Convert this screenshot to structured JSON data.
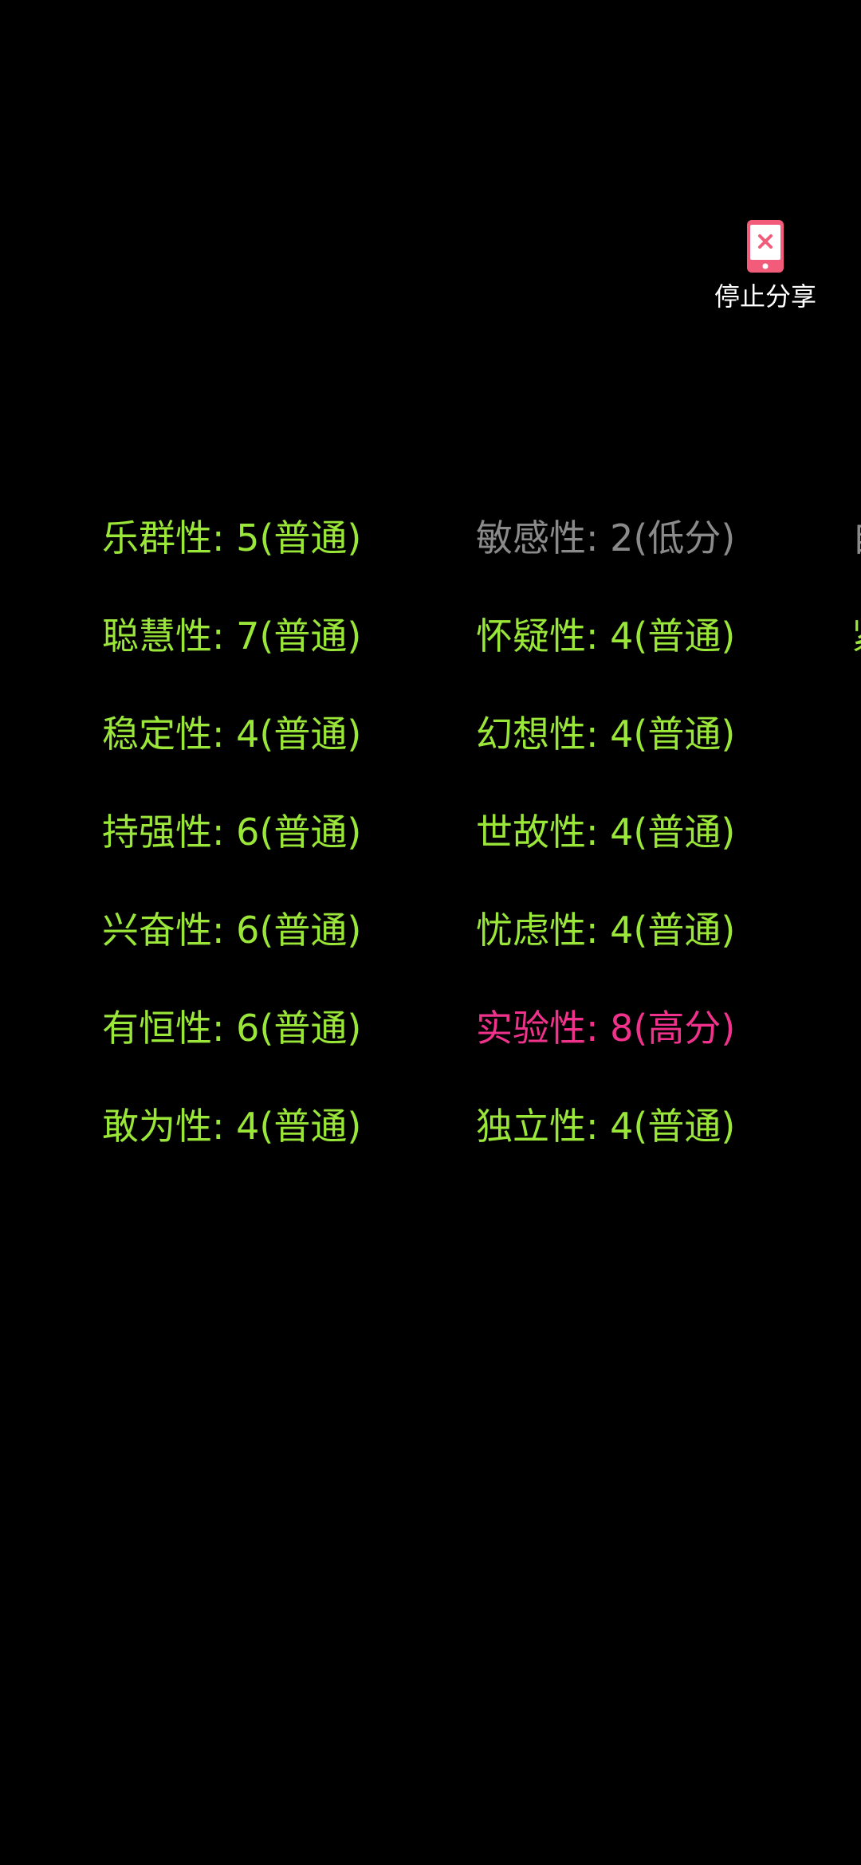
{
  "stop_share": {
    "label": "停止分享",
    "icon": "phone-stop-icon",
    "icon_color": "#f25c7a"
  },
  "colors": {
    "normal": "#9ae639",
    "low": "#8a8a8a",
    "high": "#f0328c"
  },
  "traits": {
    "column_1": [
      {
        "text": "乐群性: 5(普通)",
        "level": "normal"
      },
      {
        "text": "聪慧性: 7(普通)",
        "level": "normal"
      },
      {
        "text": "稳定性: 4(普通)",
        "level": "normal"
      },
      {
        "text": "持强性: 6(普通)",
        "level": "normal"
      },
      {
        "text": "兴奋性: 6(普通)",
        "level": "normal"
      },
      {
        "text": "有恒性: 6(普通)",
        "level": "normal"
      },
      {
        "text": "敢为性: 4(普通)",
        "level": "normal"
      }
    ],
    "column_2": [
      {
        "text": "敏感性: 2(低分)",
        "level": "low"
      },
      {
        "text": "怀疑性: 4(普通)",
        "level": "normal"
      },
      {
        "text": "幻想性: 4(普通)",
        "level": "normal"
      },
      {
        "text": "世故性: 4(普通)",
        "level": "normal"
      },
      {
        "text": "忧虑性: 4(普通)",
        "level": "normal"
      },
      {
        "text": "实验性: 8(高分)",
        "level": "high"
      },
      {
        "text": "独立性: 4(普通)",
        "level": "normal"
      }
    ],
    "column_3_partial": [
      {
        "text": "自",
        "level": "low"
      },
      {
        "text": "紧",
        "level": "normal"
      }
    ]
  }
}
